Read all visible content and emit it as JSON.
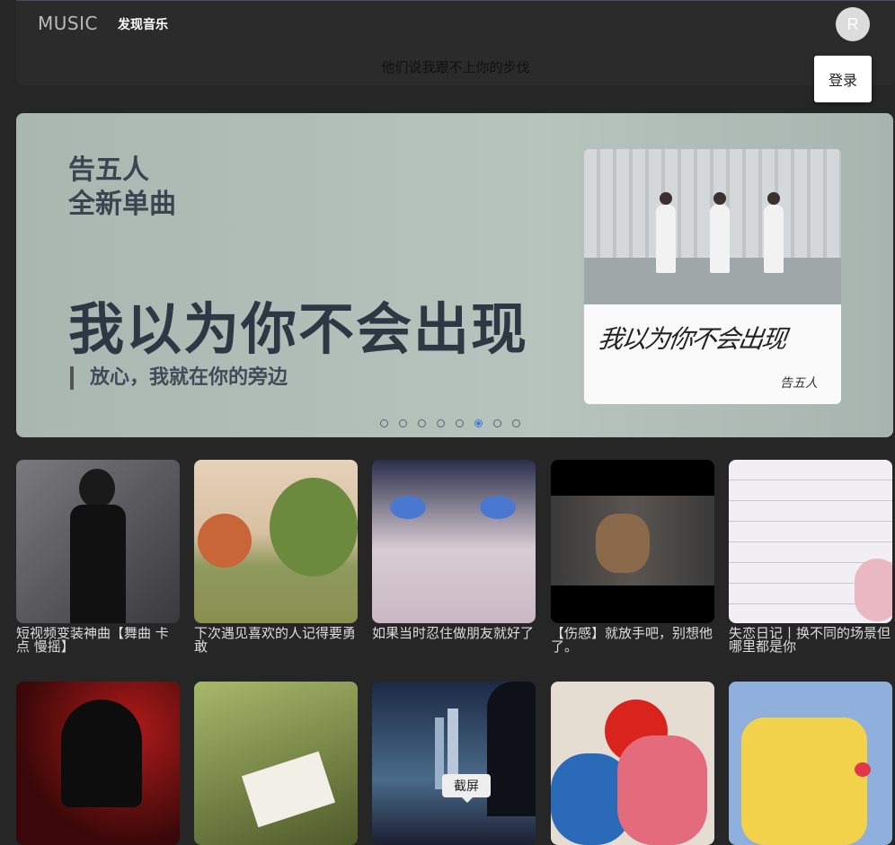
{
  "header": {
    "logo": "MUSIC",
    "nav_discover": "发现音乐",
    "avatar_letter": "R",
    "marquee": "他们说我跟不上你的步伐",
    "login_label": "登录"
  },
  "banner": {
    "subtitle_line1": "告五人",
    "subtitle_line2": "全新单曲",
    "title": "我以为你不会出现",
    "tagline": "放心，我就在你的旁边",
    "cover_script": "我以为你不会出现",
    "cover_signature": "告五人",
    "dots_count": 8,
    "active_dot": 6
  },
  "playlists_row1": [
    {
      "title": "短视频变装神曲【舞曲 卡点 慢摇】",
      "bg": "#5a5a5e"
    },
    {
      "title": "下次遇见喜欢的人记得要勇敢",
      "bg": "#d9c3a6"
    },
    {
      "title": "如果当时忍住做朋友就好了",
      "bg": "#4e5a86"
    },
    {
      "title": "【伤感】就放手吧，别想他了。",
      "bg": "#111111"
    },
    {
      "title": "失恋日记丨换不同的场景但哪里都是你",
      "bg": "#e8e4ec"
    }
  ],
  "playlists_row2": [
    {
      "title": "",
      "bg": "#7a1414"
    },
    {
      "title": "",
      "bg": "#6b7a3a"
    },
    {
      "title": "",
      "bg": "#2c3e5c"
    },
    {
      "title": "",
      "bg": "#d8cfc4"
    },
    {
      "title": "",
      "bg": "#7fa6d6"
    }
  ],
  "tooltip": "截屏"
}
